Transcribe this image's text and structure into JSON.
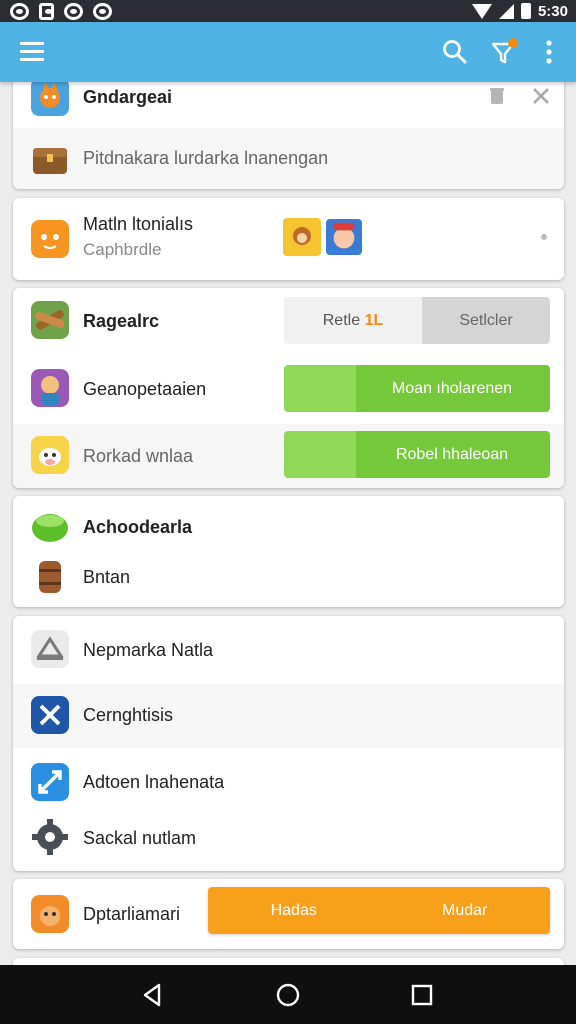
{
  "status_bar": {
    "time": "5:30"
  },
  "app_bar": {
    "icons": [
      "menu-icon",
      "search-icon",
      "filter-icon",
      "more-vert-icon"
    ],
    "accent": "#4fb3e5",
    "badge_color": "#f18b13"
  },
  "card1": {
    "title": "Gndargeai",
    "subtitle": "Pitdnakara lurdarka lnanengan",
    "actions": [
      "trash-icon",
      "close-icon"
    ]
  },
  "card2": {
    "title": "Matln ltonialıs",
    "subtitle": "Caphbrdle"
  },
  "card3": {
    "rows": [
      {
        "label": "Ragealrc",
        "buttons": {
          "left": "Retle",
          "left_badge": "1L",
          "right": "Setlcler"
        }
      },
      {
        "label": "Geanopetaaien",
        "button": "Moan ıholarenen"
      },
      {
        "label": "Rorkad wnlaa",
        "button": "Robel hhaleoan"
      }
    ]
  },
  "card4": {
    "items": [
      "Achoodearla",
      "Bntan"
    ]
  },
  "card5": {
    "items": [
      "Nepmarka Natla",
      "Cernghtisis",
      "Adtoen lnahenata",
      "Sackal nutlam"
    ]
  },
  "card6": {
    "label": "Dptarliamari",
    "left_button": "Hadas",
    "right_button": "Mudar"
  },
  "colors": {
    "green": "#74c83a",
    "orange": "#f9a01b"
  }
}
